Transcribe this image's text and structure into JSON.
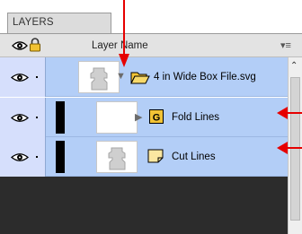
{
  "panel": {
    "tab_title": "LAYERS",
    "header": {
      "visibility_icon": "eye-icon",
      "lock_icon": "lock-icon",
      "column_label": "Layer Name",
      "menu_icon": "panel-menu-icon"
    }
  },
  "layers": [
    {
      "name": "4 in Wide Box File.svg",
      "expanded": true,
      "visible": true,
      "type_icon": "open-folder-icon",
      "has_color_bar": false
    },
    {
      "name": "Fold Lines",
      "expanded": false,
      "visible": true,
      "type_icon": "group-icon",
      "group_glyph": "G",
      "has_color_bar": true
    },
    {
      "name": "Cut Lines",
      "visible": true,
      "type_icon": "object-icon",
      "has_color_bar": true
    }
  ],
  "colors": {
    "row_selected": "#b3cef7",
    "annotation_arrow": "#e60000",
    "folder": "#f3c436"
  }
}
